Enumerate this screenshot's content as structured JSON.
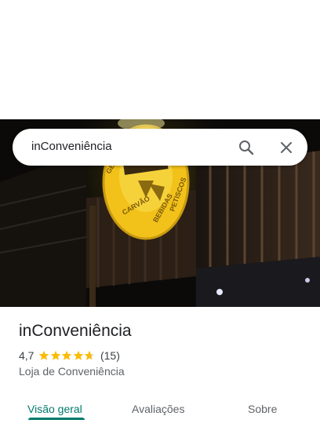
{
  "search": {
    "query": "inConveniência",
    "search_icon": "search-icon",
    "close_icon": "close-icon"
  },
  "hero": {
    "description_icon": "storefront-photo"
  },
  "place": {
    "name": "inConveniência",
    "rating": "4,7",
    "rating_value": 4.7,
    "reviews": "(15)",
    "category": "Loja de Conveniência"
  },
  "tabs": [
    {
      "label": "Visão geral",
      "active": true
    },
    {
      "label": "Avaliações",
      "active": false
    },
    {
      "label": "Sobre",
      "active": false
    }
  ],
  "colors": {
    "accent": "#00796b",
    "star": "#fbbc04",
    "star_empty": "#dadce0"
  }
}
